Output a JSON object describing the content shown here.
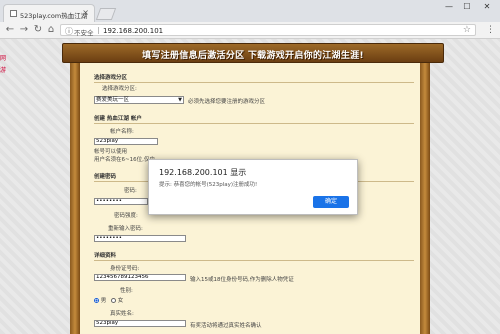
{
  "browser": {
    "tab_title": "523play.com热血江湖",
    "tab_close": "×",
    "win_min": "—",
    "win_max": "☐",
    "win_close": "✕",
    "insecure_label": "不安全",
    "url": "192.168.200.101"
  },
  "page": {
    "banner": "填写注册信息后激活分区 下载游戏开启你的江湖生涯!",
    "left_text": "网游",
    "sections": {
      "zone": "选择游戏分区",
      "account": "创建 热血江湖 帐户",
      "password": "创建密码",
      "details": "详细资料"
    },
    "zone_select_label": "选择游戏分区:",
    "zone_selected": "赛爱美玩一区",
    "zone_hint": "必须先选择您要注册的游戏分区",
    "account_label": "帐户名称:",
    "account_value": "523play",
    "account_ok": "帐号可以使用",
    "account_rule": "用户名须在6~16位,仅由",
    "password_label": "密码:",
    "password_value": "••••••••",
    "strength_label": "密码强度:",
    "confirm_label": "重新输入密码:",
    "confirm_value": "••••••••",
    "id_label": "身份证号码:",
    "id_value": "123456789123456",
    "id_hint": "输入15或18位身份号码,作为删除人物凭证",
    "gender_label": "性别:",
    "gender_male": "男",
    "gender_female": "女",
    "realname_label": "真实姓名:",
    "realname_value": "523play",
    "realname_hint": "有奖活动将通过真实姓名确认"
  },
  "dialog": {
    "title": "192.168.200.101 显示",
    "message": "提示: 恭喜您的帐号(523play)注册成功!",
    "ok": "确定"
  }
}
